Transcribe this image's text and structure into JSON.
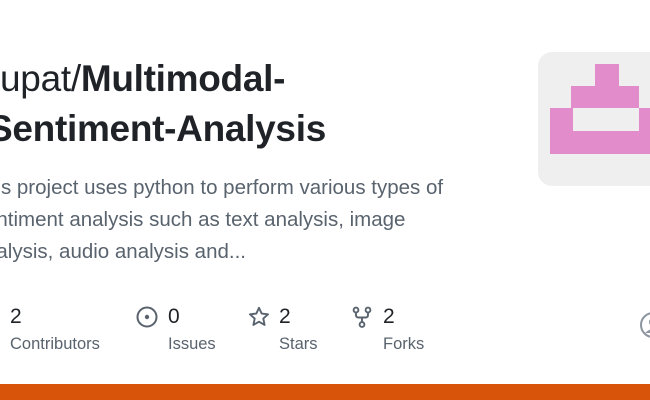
{
  "repo": {
    "owner_prefix": "rupat/",
    "name_line1": "Multimodal-",
    "name_line2": "Sentiment-Analysis"
  },
  "description": {
    "line1": "his project uses python to perform various types of",
    "line2": "entiment analysis such as text analysis, image",
    "line3": "nalysis, audio analysis and..."
  },
  "stats": {
    "contributors": {
      "count": "2",
      "label": "Contributors"
    },
    "issues": {
      "count": "0",
      "label": "Issues",
      "icon": "issue-opened-icon"
    },
    "stars": {
      "count": "2",
      "label": "Stars",
      "icon": "star-icon"
    },
    "forks": {
      "count": "2",
      "label": "Forks",
      "icon": "repo-forked-icon"
    }
  },
  "colors": {
    "title": "#1f2328",
    "muted": "#59636e",
    "avatar_bg": "#efefef",
    "identicon": "#e28ccc",
    "bottom_bar": "#d9540b"
  }
}
